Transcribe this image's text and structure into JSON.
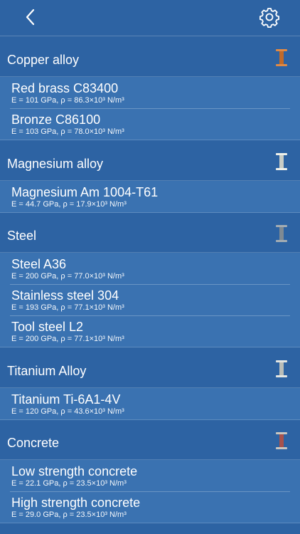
{
  "nav": {
    "back_icon": "chevron-left-icon",
    "settings_icon": "gear-icon"
  },
  "colors": {
    "background": "#2d63a3",
    "row_background": "#3a72b1",
    "copper": "#d27a3a",
    "silver": "#d8dcd6",
    "steel": "#8c969e",
    "concrete": "#b0605a"
  },
  "sections": [
    {
      "title": "Copper alloy",
      "icon": "copper-beam-icon",
      "items": [
        {
          "name": "Red brass C83400",
          "props": "E = 101 GPa, ρ = 86.3×10³ N/m³"
        },
        {
          "name": "Bronze C86100",
          "props": "E = 103 GPa, ρ = 78.0×10³ N/m³"
        }
      ]
    },
    {
      "title": "Magnesium alloy",
      "icon": "magnesium-beam-icon",
      "items": [
        {
          "name": "Magnesium Am 1004-T61",
          "props": "E = 44.7 GPa, ρ = 17.9×10³ N/m³"
        }
      ]
    },
    {
      "title": "Steel",
      "icon": "steel-beam-icon",
      "items": [
        {
          "name": "Steel A36",
          "props": "E = 200 GPa, ρ = 77.0×10³ N/m³"
        },
        {
          "name": "Stainless steel 304",
          "props": "E = 193 GPa, ρ = 77.1×10³ N/m³"
        },
        {
          "name": "Tool steel L2",
          "props": "E = 200 GPa, ρ = 77.1×10³ N/m³"
        }
      ]
    },
    {
      "title": "Titanium Alloy",
      "icon": "titanium-beam-icon",
      "items": [
        {
          "name": "Titanium Ti-6A1-4V",
          "props": "E = 120 GPa, ρ = 43.6×10³ N/m³"
        }
      ]
    },
    {
      "title": "Concrete",
      "icon": "concrete-beam-icon",
      "items": [
        {
          "name": "Low strength concrete",
          "props": "E = 22.1 GPa, ρ = 23.5×10³ N/m³"
        },
        {
          "name": "High strength concrete",
          "props": "E = 29.0 GPa, ρ = 23.5×10³ N/m³"
        }
      ]
    }
  ]
}
